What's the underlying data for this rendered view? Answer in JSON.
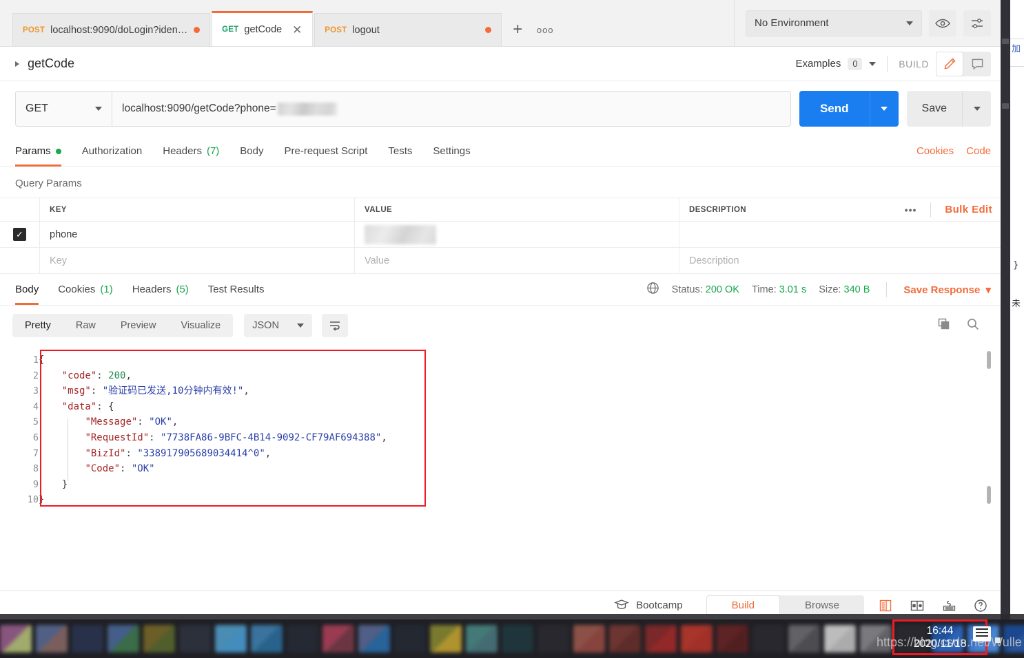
{
  "tabs": [
    {
      "method": "POST",
      "title": "localhost:9090/doLogin?identi...",
      "unsaved": true,
      "active": false
    },
    {
      "method": "GET",
      "title": "getCode",
      "unsaved": false,
      "active": true
    },
    {
      "method": "POST",
      "title": "logout",
      "unsaved": true,
      "active": false
    }
  ],
  "tabbar": {
    "new_tab": "+",
    "more": "ooo"
  },
  "environment": {
    "selected": "No Environment"
  },
  "request_header": {
    "name": "getCode",
    "examples_label": "Examples",
    "examples_count": "0",
    "build_label": "BUILD"
  },
  "url_row": {
    "method": "GET",
    "url_text": "localhost:9090/getCode?phone=",
    "url_redacted": true,
    "send_label": "Send",
    "save_label": "Save"
  },
  "request_tabs": [
    {
      "label": "Params",
      "dot": true,
      "active": true
    },
    {
      "label": "Authorization",
      "active": false
    },
    {
      "label": "Headers",
      "count": "(7)",
      "active": false
    },
    {
      "label": "Body",
      "active": false
    },
    {
      "label": "Pre-request Script",
      "active": false
    },
    {
      "label": "Tests",
      "active": false
    },
    {
      "label": "Settings",
      "active": false
    }
  ],
  "request_links": [
    {
      "label": "Cookies"
    },
    {
      "label": "Code"
    }
  ],
  "query_params": {
    "section_label": "Query Params",
    "columns": [
      "KEY",
      "VALUE",
      "DESCRIPTION"
    ],
    "bulk_edit_label": "Bulk Edit",
    "rows": [
      {
        "checked": true,
        "key": "phone",
        "value_redacted": true,
        "value": "",
        "description": ""
      }
    ],
    "empty_row": {
      "key": "Key",
      "value": "Value",
      "description": "Description"
    }
  },
  "response": {
    "tabs": [
      {
        "label": "Body",
        "active": true
      },
      {
        "label": "Cookies",
        "count": "(1)",
        "active": false
      },
      {
        "label": "Headers",
        "count": "(5)",
        "active": false
      },
      {
        "label": "Test Results",
        "active": false
      }
    ],
    "status_label": "Status:",
    "status_value": "200 OK",
    "time_label": "Time:",
    "time_value": "3.01 s",
    "size_label": "Size:",
    "size_value": "340 B",
    "save_response_label": "Save Response",
    "view_modes": [
      {
        "label": "Pretty",
        "active": true
      },
      {
        "label": "Raw",
        "active": false
      },
      {
        "label": "Preview",
        "active": false
      },
      {
        "label": "Visualize",
        "active": false
      }
    ],
    "format": "JSON",
    "body_lines": [
      {
        "n": 1,
        "indent": 0,
        "tokens": [
          {
            "t": "pun",
            "v": "{"
          }
        ]
      },
      {
        "n": 2,
        "indent": 1,
        "tokens": [
          {
            "t": "key",
            "v": "\"code\""
          },
          {
            "t": "pun",
            "v": ": "
          },
          {
            "t": "num",
            "v": "200"
          },
          {
            "t": "pun",
            "v": ","
          }
        ]
      },
      {
        "n": 3,
        "indent": 1,
        "tokens": [
          {
            "t": "key",
            "v": "\"msg\""
          },
          {
            "t": "pun",
            "v": ": "
          },
          {
            "t": "str",
            "v": "\"验证码已发送,10分钟内有效!\""
          },
          {
            "t": "pun",
            "v": ","
          }
        ]
      },
      {
        "n": 4,
        "indent": 1,
        "tokens": [
          {
            "t": "key",
            "v": "\"data\""
          },
          {
            "t": "pun",
            "v": ": {"
          }
        ]
      },
      {
        "n": 5,
        "indent": 2,
        "tokens": [
          {
            "t": "key",
            "v": "\"Message\""
          },
          {
            "t": "pun",
            "v": ": "
          },
          {
            "t": "str",
            "v": "\"OK\""
          },
          {
            "t": "pun",
            "v": ","
          }
        ]
      },
      {
        "n": 6,
        "indent": 2,
        "tokens": [
          {
            "t": "key",
            "v": "\"RequestId\""
          },
          {
            "t": "pun",
            "v": ": "
          },
          {
            "t": "str",
            "v": "\"7738FA86-9BFC-4B14-9092-CF79AF694388\""
          },
          {
            "t": "pun",
            "v": ","
          }
        ]
      },
      {
        "n": 7,
        "indent": 2,
        "tokens": [
          {
            "t": "key",
            "v": "\"BizId\""
          },
          {
            "t": "pun",
            "v": ": "
          },
          {
            "t": "str",
            "v": "\"338917905689034414^0\""
          },
          {
            "t": "pun",
            "v": ","
          }
        ]
      },
      {
        "n": 8,
        "indent": 2,
        "tokens": [
          {
            "t": "key",
            "v": "\"Code\""
          },
          {
            "t": "pun",
            "v": ": "
          },
          {
            "t": "str",
            "v": "\"OK\""
          }
        ]
      },
      {
        "n": 9,
        "indent": 1,
        "tokens": [
          {
            "t": "pun",
            "v": "}"
          }
        ]
      },
      {
        "n": 10,
        "indent": 0,
        "tokens": [
          {
            "t": "pun",
            "v": "}"
          }
        ]
      }
    ]
  },
  "footer": {
    "bootcamp_label": "Bootcamp",
    "build_label": "Build",
    "browse_label": "Browse"
  },
  "taskbar": {
    "clock_time": "16:44",
    "clock_date": "2020/11/18",
    "watermark": "https://blog.csdn.net/Wulle"
  },
  "colors": {
    "accent_orange": "#f26b3a",
    "send_blue": "#1a7ef0",
    "status_green": "#17a84c",
    "highlight_red": "#ee1b24"
  },
  "background_window": {
    "text_1": "加",
    "text_2": "}",
    "text_3": "未"
  }
}
